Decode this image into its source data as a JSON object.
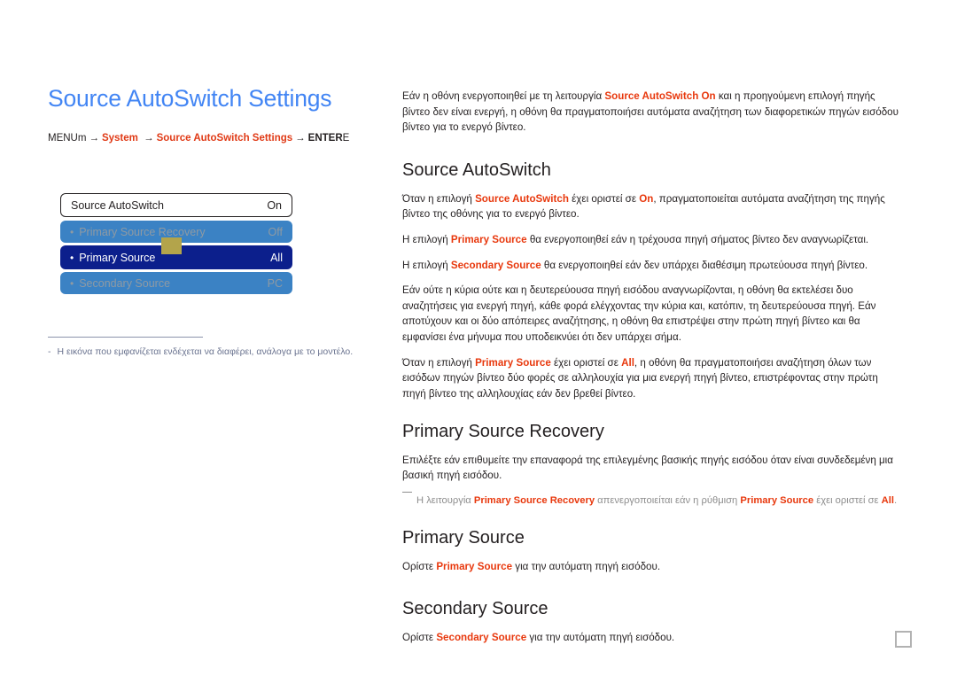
{
  "page": {
    "title": "Source AutoSwitch Settings",
    "breadcrumb": {
      "start": "MENU",
      "start_suffix": "m",
      "arrow": "→",
      "step1": "System",
      "step2": "Source AutoSwitch Settings",
      "end": "ENTER",
      "end_suffix": "E"
    },
    "page_marker": "page-marker-square"
  },
  "osd_menu": {
    "rows": [
      {
        "name": "source-autoswitch",
        "bullet": "",
        "label": "Source AutoSwitch",
        "value": "On",
        "state": "top"
      },
      {
        "name": "primary-source-recovery",
        "bullet": "•",
        "label": "Primary Source Recovery",
        "value": "Off",
        "state": "disabled"
      },
      {
        "name": "primary-source",
        "bullet": "•",
        "label": "Primary Source",
        "value": "All",
        "state": "selected"
      },
      {
        "name": "secondary-source",
        "bullet": "•",
        "label": "Secondary Source",
        "value": "PC",
        "state": "disabled"
      }
    ],
    "cursor_color": "#b3a44b"
  },
  "left_note": {
    "dash": "-",
    "text": "Η εικόνα που εμφανίζεται ενδέχεται να διαφέρει, ανάλογα με το μοντέλο."
  },
  "intro": {
    "p1_a": "Εάν η οθόνη ενεργοποιηθεί με τη λειτουργία ",
    "p1_red": "Source AutoSwitch On",
    "p1_b": " και η προηγούμενη επιλογή πηγής βίντεο δεν είναι ενεργή, η οθόνη θα πραγματοποιήσει αυτόματα αναζήτηση των διαφορετικών πηγών εισόδου βίντεο για το ενεργό βίντεο."
  },
  "section_autoswitch": {
    "heading": "Source AutoSwitch",
    "p1_a": "Όταν η επιλογή ",
    "p1_red1": "Source AutoSwitch",
    "p1_b": " έχει οριστεί σε ",
    "p1_red2": "On",
    "p1_c": ", πραγματοποιείται αυτόματα αναζήτηση της πηγής βίντεο της οθόνης για το ενεργό βίντεο.",
    "p2_a": "Η επιλογή ",
    "p2_red": "Primary Source",
    "p2_b": " θα ενεργοποιηθεί εάν η τρέχουσα πηγή σήματος βίντεο δεν αναγνωρίζεται.",
    "p3_a": "Η επιλογή ",
    "p3_red": "Secondary Source",
    "p3_b": " θα ενεργοποιηθεί εάν δεν υπάρχει διαθέσιμη πρωτεύουσα πηγή βίντεο.",
    "p4": "Εάν ούτε η κύρια ούτε και η δευτερεύουσα πηγή εισόδου αναγνωρίζονται, η οθόνη θα εκτελέσει δυο αναζητήσεις για ενεργή πηγή, κάθε φορά ελέγχοντας την κύρια και, κατόπιν, τη δευτερεύουσα πηγή. Εάν αποτύχουν και οι δύο απόπειρες αναζήτησης, η οθόνη θα επιστρέψει στην πρώτη πηγή βίντεο και θα εμφανίσει ένα μήνυμα που υποδεικνύει ότι δεν υπάρχει σήμα.",
    "p5_a": "Όταν η επιλογή ",
    "p5_red1": "Primary Source",
    "p5_b": " έχει οριστεί σε ",
    "p5_red2": "All",
    "p5_c": ", η οθόνη θα πραγματοποιήσει αναζήτηση όλων των εισόδων πηγών βίντεο δύο φορές σε αλληλουχία για μια ενεργή πηγή βίντεο, επιστρέφοντας στην πρώτη πηγή βίντεο της αλληλουχίας εάν δεν βρεθεί βίντεο."
  },
  "section_recovery": {
    "heading": "Primary Source Recovery",
    "p1": "Επιλέξτε εάν επιθυμείτε την επαναφορά της επιλεγμένης βασικής πηγής εισόδου όταν είναι συνδεδεμένη μια βασική πηγή εισόδου.",
    "note_a": "Η λειτουργία ",
    "note_red1": "Primary Source Recovery",
    "note_b": " απενεργοποιείται εάν η ρύθμιση ",
    "note_red2": "Primary Source",
    "note_c": " έχει οριστεί σε ",
    "note_red3": "All",
    "note_d": "."
  },
  "section_primary": {
    "heading": "Primary Source",
    "p1_a": "Ορίστε ",
    "p1_red": "Primary Source",
    "p1_b": " για την αυτόματη πηγή εισόδου."
  },
  "section_secondary": {
    "heading": "Secondary Source",
    "p1_a": "Ορίστε ",
    "p1_red": "Secondary Source",
    "p1_b": " για την αυτόματη πηγή εισόδου."
  },
  "colors": {
    "title_blue": "#4285f4",
    "accent_red": "#e8380d",
    "breadcrumb_red": "#e03a16",
    "osd_selected_bg": "#0c1f8c",
    "osd_disabled_bg": "#3b82c4",
    "osd_cursor": "#b3a44b",
    "note_grey": "#6b7490"
  }
}
